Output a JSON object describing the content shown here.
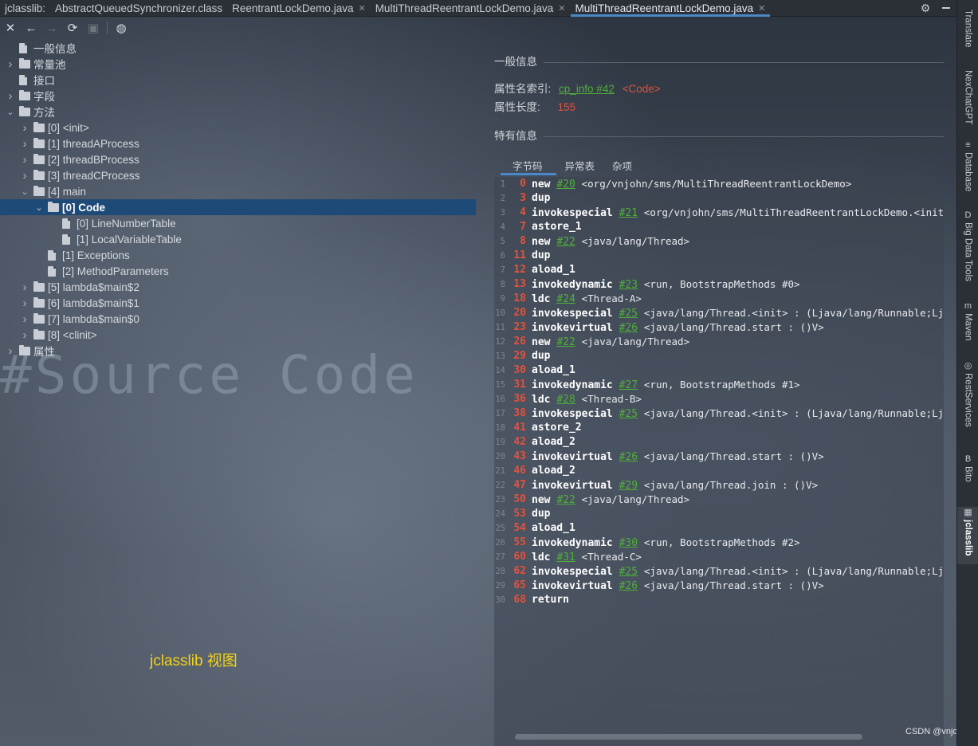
{
  "tabs": {
    "prefix": "jclasslib:",
    "items": [
      {
        "label": "AbstractQueuedSynchronizer.class"
      },
      {
        "label": "ReentrantLockDemo.java"
      },
      {
        "label": "MultiThreadReentrantLockDemo.java"
      },
      {
        "label": "MultiThreadReentrantLockDemo.java",
        "active": true
      }
    ]
  },
  "toolbar": {
    "close_icon": "close-icon",
    "back_icon": "arrow-left-icon",
    "forward_icon": "arrow-right-icon",
    "refresh_icon": "refresh-icon",
    "save_icon": "save-icon",
    "web_icon": "globe-icon"
  },
  "tree": [
    {
      "label": "一般信息",
      "level": 0,
      "icon": "file",
      "expand": "none"
    },
    {
      "label": "常量池",
      "level": 0,
      "icon": "folder",
      "expand": "collapsed"
    },
    {
      "label": "接口",
      "level": 0,
      "icon": "file",
      "expand": "none"
    },
    {
      "label": "字段",
      "level": 0,
      "icon": "folder",
      "expand": "collapsed"
    },
    {
      "label": "方法",
      "level": 0,
      "icon": "folder",
      "expand": "expanded"
    },
    {
      "label": "[0] <init>",
      "level": 1,
      "icon": "folder",
      "expand": "collapsed"
    },
    {
      "label": "[1] threadAProcess",
      "level": 1,
      "icon": "folder",
      "expand": "collapsed"
    },
    {
      "label": "[2] threadBProcess",
      "level": 1,
      "icon": "folder",
      "expand": "collapsed"
    },
    {
      "label": "[3] threadCProcess",
      "level": 1,
      "icon": "folder",
      "expand": "collapsed"
    },
    {
      "label": "[4] main",
      "level": 1,
      "icon": "folder",
      "expand": "expanded"
    },
    {
      "label": "[0] Code",
      "level": 2,
      "icon": "folder",
      "expand": "expanded",
      "selected": true
    },
    {
      "label": "[0] LineNumberTable",
      "level": 3,
      "icon": "file",
      "expand": "none"
    },
    {
      "label": "[1] LocalVariableTable",
      "level": 3,
      "icon": "file",
      "expand": "none"
    },
    {
      "label": "[1] Exceptions",
      "level": 2,
      "icon": "file",
      "expand": "none"
    },
    {
      "label": "[2] MethodParameters",
      "level": 2,
      "icon": "file",
      "expand": "none"
    },
    {
      "label": "[5] lambda$main$2",
      "level": 1,
      "icon": "folder",
      "expand": "collapsed"
    },
    {
      "label": "[6] lambda$main$1",
      "level": 1,
      "icon": "folder",
      "expand": "collapsed"
    },
    {
      "label": "[7] lambda$main$0",
      "level": 1,
      "icon": "folder",
      "expand": "collapsed"
    },
    {
      "label": "[8] <clinit>",
      "level": 1,
      "icon": "folder",
      "expand": "collapsed"
    },
    {
      "label": "属性",
      "level": 0,
      "icon": "folder",
      "expand": "collapsed"
    }
  ],
  "background_text": "#Source Code",
  "caption": "jclasslib 视图",
  "general": {
    "title": "一般信息",
    "name_index_label": "属性名索引:",
    "name_index_link": "cp_info #42",
    "name_index_value": "<Code>",
    "length_label": "属性长度:",
    "length_value": "155"
  },
  "specific": {
    "title": "特有信息",
    "subtabs": [
      "字节码",
      "异常表",
      "杂项"
    ]
  },
  "bytecode": [
    {
      "ln": "1",
      "off": "0",
      "op": "new",
      "ref": "#20",
      "rest": "<org/vnjohn/sms/MultiThreadReentrantLockDemo>"
    },
    {
      "ln": "2",
      "off": "3",
      "op": "dup",
      "ref": "",
      "rest": ""
    },
    {
      "ln": "3",
      "off": "4",
      "op": "invokespecial",
      "ref": "#21",
      "rest": "<org/vnjohn/sms/MultiThreadReentrantLockDemo.<init> :"
    },
    {
      "ln": "4",
      "off": "7",
      "op": "astore_1",
      "ref": "",
      "rest": ""
    },
    {
      "ln": "5",
      "off": "8",
      "op": "new",
      "ref": "#22",
      "rest": "<java/lang/Thread>"
    },
    {
      "ln": "6",
      "off": "11",
      "op": "dup",
      "ref": "",
      "rest": ""
    },
    {
      "ln": "7",
      "off": "12",
      "op": "aload_1",
      "ref": "",
      "rest": ""
    },
    {
      "ln": "8",
      "off": "13",
      "op": "invokedynamic",
      "ref": "#23",
      "rest": "<run, BootstrapMethods #0>"
    },
    {
      "ln": "9",
      "off": "18",
      "op": "ldc",
      "ref": "#24",
      "rest": "<Thread-A>"
    },
    {
      "ln": "10",
      "off": "20",
      "op": "invokespecial",
      "ref": "#25",
      "rest": "<java/lang/Thread.<init> : (Ljava/lang/Runnable;Ljava"
    },
    {
      "ln": "11",
      "off": "23",
      "op": "invokevirtual",
      "ref": "#26",
      "rest": "<java/lang/Thread.start : ()V>"
    },
    {
      "ln": "12",
      "off": "26",
      "op": "new",
      "ref": "#22",
      "rest": "<java/lang/Thread>"
    },
    {
      "ln": "13",
      "off": "29",
      "op": "dup",
      "ref": "",
      "rest": ""
    },
    {
      "ln": "14",
      "off": "30",
      "op": "aload_1",
      "ref": "",
      "rest": ""
    },
    {
      "ln": "15",
      "off": "31",
      "op": "invokedynamic",
      "ref": "#27",
      "rest": "<run, BootstrapMethods #1>"
    },
    {
      "ln": "16",
      "off": "36",
      "op": "ldc",
      "ref": "#28",
      "rest": "<Thread-B>"
    },
    {
      "ln": "17",
      "off": "38",
      "op": "invokespecial",
      "ref": "#25",
      "rest": "<java/lang/Thread.<init> : (Ljava/lang/Runnable;Ljava"
    },
    {
      "ln": "18",
      "off": "41",
      "op": "astore_2",
      "ref": "",
      "rest": ""
    },
    {
      "ln": "19",
      "off": "42",
      "op": "aload_2",
      "ref": "",
      "rest": ""
    },
    {
      "ln": "20",
      "off": "43",
      "op": "invokevirtual",
      "ref": "#26",
      "rest": "<java/lang/Thread.start : ()V>"
    },
    {
      "ln": "21",
      "off": "46",
      "op": "aload_2",
      "ref": "",
      "rest": ""
    },
    {
      "ln": "22",
      "off": "47",
      "op": "invokevirtual",
      "ref": "#29",
      "rest": "<java/lang/Thread.join : ()V>"
    },
    {
      "ln": "23",
      "off": "50",
      "op": "new",
      "ref": "#22",
      "rest": "<java/lang/Thread>"
    },
    {
      "ln": "24",
      "off": "53",
      "op": "dup",
      "ref": "",
      "rest": ""
    },
    {
      "ln": "25",
      "off": "54",
      "op": "aload_1",
      "ref": "",
      "rest": ""
    },
    {
      "ln": "26",
      "off": "55",
      "op": "invokedynamic",
      "ref": "#30",
      "rest": "<run, BootstrapMethods #2>"
    },
    {
      "ln": "27",
      "off": "60",
      "op": "ldc",
      "ref": "#31",
      "rest": "<Thread-C>"
    },
    {
      "ln": "28",
      "off": "62",
      "op": "invokespecial",
      "ref": "#25",
      "rest": "<java/lang/Thread.<init> : (Ljava/lang/Runnable;Ljava"
    },
    {
      "ln": "29",
      "off": "65",
      "op": "invokevirtual",
      "ref": "#26",
      "rest": "<java/lang/Thread.start : ()V>"
    },
    {
      "ln": "30",
      "off": "68",
      "op": "return",
      "ref": "",
      "rest": ""
    }
  ],
  "watermark": "CSDN @vnjohn",
  "tool_strip": [
    {
      "label": "Translate",
      "icon": ""
    },
    {
      "label": "NexChatGPT",
      "icon": ""
    },
    {
      "label": "Database",
      "icon": "≡"
    },
    {
      "label": "Big Data Tools",
      "icon": "D"
    },
    {
      "label": "Maven",
      "icon": "m"
    },
    {
      "label": "RestServices",
      "icon": "◎"
    },
    {
      "label": "Bito",
      "icon": "B"
    },
    {
      "label": "jclasslib",
      "icon": "▦",
      "active": true
    }
  ],
  "colors": {
    "accent": "#4a88c7",
    "selection": "#1e4a78",
    "offset_red": "#e0533f",
    "link_green": "#4fae3a",
    "caption_yellow": "#f2d21a"
  }
}
